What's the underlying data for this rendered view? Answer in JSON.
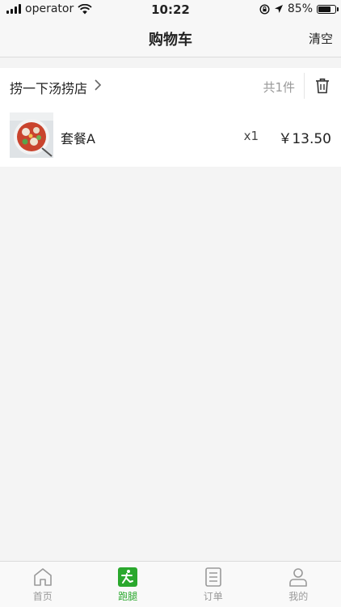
{
  "status_bar": {
    "carrier": "operator",
    "time": "10:22",
    "battery_percent": "85%",
    "battery_level": 0.85,
    "icons": [
      "signal-icon",
      "wifi-icon",
      "orientation-lock-icon",
      "location-icon",
      "battery-icon"
    ]
  },
  "nav": {
    "title": "购物车",
    "clear_label": "清空"
  },
  "cart": {
    "store_name": "捞一下汤捞店",
    "item_count_label": "共1件",
    "items": [
      {
        "name": "套餐A",
        "qty": "x1",
        "price": "￥13.50"
      }
    ]
  },
  "tab_bar": {
    "tabs": [
      {
        "label": "首页",
        "icon": "home-icon",
        "active": false
      },
      {
        "label": "跑腿",
        "icon": "run-icon",
        "active": true
      },
      {
        "label": "订单",
        "icon": "order-list-icon",
        "active": false
      },
      {
        "label": "我的",
        "icon": "user-icon",
        "active": false
      }
    ]
  },
  "colors": {
    "accent": "#2aa82d",
    "inactive": "#999999",
    "background": "#f4f4f4"
  }
}
